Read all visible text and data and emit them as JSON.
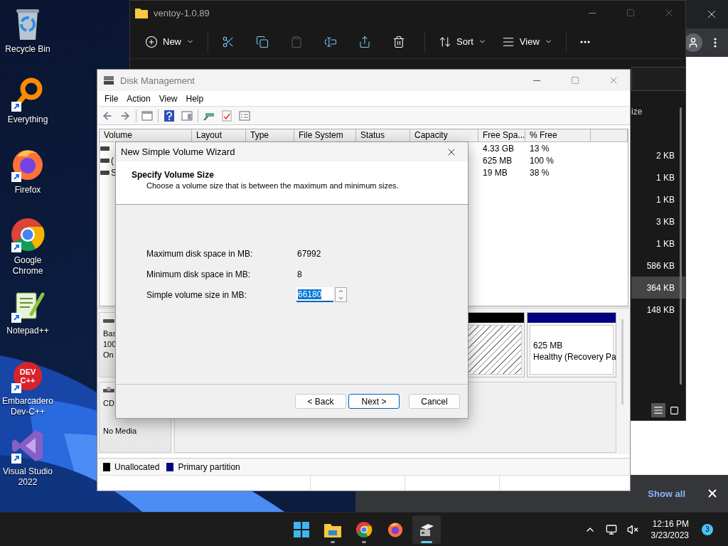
{
  "desktop_icons": [
    {
      "label": "Recycle Bin",
      "kind": "recycle",
      "shortcut": false
    },
    {
      "label": "Everything",
      "kind": "magnifier",
      "shortcut": true
    },
    {
      "label": "Firefox",
      "kind": "firefox",
      "shortcut": true
    },
    {
      "label": "Google Chrome",
      "kind": "chrome",
      "shortcut": true
    },
    {
      "label": "Notepad++",
      "kind": "notepad",
      "shortcut": true
    },
    {
      "label": "Embarcadero Dev-C++",
      "kind": "devcpp",
      "icon_text": "DEV C++",
      "shortcut": true
    },
    {
      "label": "Visual Studio 2022",
      "kind": "vs",
      "shortcut": true
    }
  ],
  "browser": {
    "download_bar": {
      "show_all": "Show all"
    }
  },
  "explorer": {
    "title": "ventoy-1.0.89",
    "toolbar": [
      {
        "kind": "new",
        "label": "New",
        "dropdown": true,
        "disabled": false
      },
      {
        "kind": "cut",
        "dropdown": false,
        "disabled": false
      },
      {
        "kind": "copy",
        "dropdown": false,
        "disabled": false
      },
      {
        "kind": "paste",
        "dropdown": false,
        "disabled": true
      },
      {
        "kind": "rename",
        "dropdown": false,
        "disabled": false
      },
      {
        "kind": "share",
        "dropdown": false,
        "disabled": false
      },
      {
        "kind": "delete",
        "dropdown": false,
        "disabled": false
      },
      {
        "kind": "sort",
        "label": "Sort",
        "dropdown": true,
        "disabled": false
      },
      {
        "kind": "view",
        "label": "View",
        "dropdown": true,
        "disabled": false
      },
      {
        "kind": "more",
        "dropdown": false,
        "disabled": false
      }
    ],
    "size_header": "ize",
    "sizes": [
      {
        "text": "2 KB",
        "selected": false
      },
      {
        "text": "1 KB",
        "selected": false
      },
      {
        "text": "1 KB",
        "selected": false
      },
      {
        "text": "3 KB",
        "selected": false
      },
      {
        "text": "1 KB",
        "selected": false
      },
      {
        "text": "586 KB",
        "selected": false
      },
      {
        "text": "364 KB",
        "selected": true
      },
      {
        "text": "148 KB",
        "selected": false
      }
    ]
  },
  "disk_management": {
    "title": "Disk Management",
    "menu": [
      "File",
      "Action",
      "View",
      "Help"
    ],
    "columns": [
      "Volume",
      "Layout",
      "Type",
      "File System",
      "Status",
      "Capacity",
      "Free Spa...",
      "% Free"
    ],
    "rows": [
      {
        "free_space": "4.33 GB",
        "percent_free": "13 %"
      },
      {
        "volume": "(",
        "free_space": "625 MB",
        "percent_free": "100 %"
      },
      {
        "volume": "S",
        "free_space": "19 MB",
        "percent_free": "38 %"
      }
    ],
    "disks": [
      {
        "kind": "disk",
        "label_lines": [
          "Bas",
          "100",
          "On"
        ],
        "partitions": [
          {
            "kind": "unallocated"
          },
          {
            "kind": "primary",
            "size": "625 MB",
            "status": "Healthy (Recovery Pa"
          }
        ]
      },
      {
        "kind": "cdrom",
        "label_lines": [
          "CD"
        ],
        "media": "No Media"
      }
    ],
    "legend": [
      {
        "kind": "unallocated",
        "label": "Unallocated",
        "color": "#000000"
      },
      {
        "kind": "primary",
        "label": "Primary partition",
        "color": "#000080"
      }
    ]
  },
  "wizard": {
    "title": "New Simple Volume Wizard",
    "heading": "Specify Volume Size",
    "description": "Choose a volume size that is between the maximum and minimum sizes.",
    "fields": [
      {
        "kind": "readonly",
        "label": "Maximum disk space in MB:",
        "value": "67992"
      },
      {
        "kind": "readonly",
        "label": "Minimum disk space in MB:",
        "value": "8"
      },
      {
        "kind": "spin",
        "label": "Simple volume size in MB:",
        "value": "66180",
        "text_selected": true
      }
    ],
    "buttons": [
      {
        "label": "< Back",
        "default": false
      },
      {
        "label": "Next >",
        "default": true
      },
      {
        "label": "Cancel",
        "default": false
      }
    ]
  },
  "taskbar": {
    "apps": [
      {
        "kind": "start",
        "running": false,
        "active": false
      },
      {
        "kind": "explorer",
        "running": true,
        "active": false
      },
      {
        "kind": "chrome",
        "running": true,
        "active": false
      },
      {
        "kind": "firefox",
        "running": false,
        "active": false
      },
      {
        "kind": "diskmgmt",
        "running": true,
        "active": true
      }
    ],
    "time": "12:16 PM",
    "date": "3/23/2023",
    "notifications": "3"
  }
}
